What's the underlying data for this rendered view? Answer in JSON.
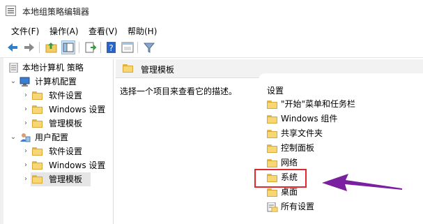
{
  "window": {
    "title": "本地组策略编辑器"
  },
  "menubar": [
    "文件(F)",
    "操作(A)",
    "查看(V)",
    "帮助(H)"
  ],
  "toolbar": {
    "buttons": [
      {
        "name": "back-icon"
      },
      {
        "name": "forward-icon"
      },
      {
        "name": "up-folder-icon"
      },
      {
        "name": "show-hide-tree-icon"
      },
      {
        "name": "export-list-icon"
      },
      {
        "name": "help-icon"
      },
      {
        "name": "properties-icon"
      },
      {
        "name": "filter-icon"
      }
    ]
  },
  "tree": {
    "root": "本地计算机 策略",
    "computer_config": "计算机配置",
    "computer_children": [
      "软件设置",
      "Windows 设置",
      "管理模板"
    ],
    "user_config": "用户配置",
    "user_children": [
      "软件设置",
      "Windows 设置",
      "管理模板"
    ]
  },
  "right": {
    "header": "管理模板",
    "description": "选择一个项目来查看它的描述。",
    "column_header": "设置",
    "items": [
      "\"开始\"菜单和任务栏",
      "Windows 组件",
      "共享文件夹",
      "控制面板",
      "网络",
      "系统",
      "桌面",
      "所有设置"
    ]
  },
  "annotation": {
    "arrow_color": "#7a1fa0",
    "box_color": "#e5262e"
  }
}
